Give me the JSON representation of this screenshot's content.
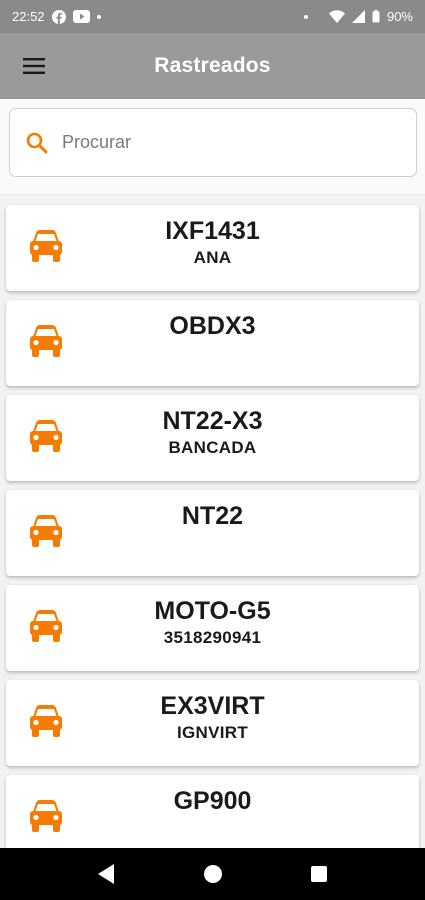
{
  "status_bar": {
    "time": "22:52",
    "battery": "90%"
  },
  "app_bar": {
    "title": "Rastreados",
    "menu_icon": "hamburger-menu-icon"
  },
  "search": {
    "placeholder": "Procurar",
    "value": "",
    "icon": "search-icon"
  },
  "colors": {
    "accent": "#f57c00",
    "app_bar": "#9a9a9a",
    "status_bar": "#8a8a8a"
  },
  "vehicles": [
    {
      "title": "IXF1431",
      "subtitle": "ANA",
      "icon": "car-icon"
    },
    {
      "title": "OBDX3",
      "subtitle": "",
      "icon": "car-icon"
    },
    {
      "title": "NT22-X3",
      "subtitle": "BANCADA",
      "icon": "car-icon"
    },
    {
      "title": "NT22",
      "subtitle": "",
      "icon": "car-icon"
    },
    {
      "title": "MOTO-G5",
      "subtitle": "3518290941",
      "icon": "car-icon"
    },
    {
      "title": "EX3VIRT",
      "subtitle": "IGNVIRT",
      "icon": "car-icon"
    },
    {
      "title": "GP900",
      "subtitle": "",
      "icon": "car-icon"
    }
  ]
}
